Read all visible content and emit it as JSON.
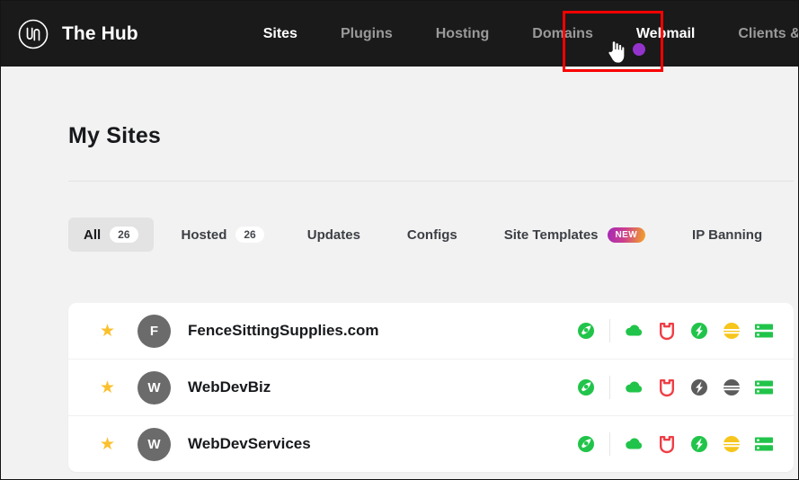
{
  "topbar": {
    "logo_icon": "wpmudev-circle-logo-icon",
    "brand": "The Hub",
    "nav": [
      {
        "label": "Sites",
        "active": true
      },
      {
        "label": "Plugins",
        "active": false
      },
      {
        "label": "Hosting",
        "active": false
      },
      {
        "label": "Domains",
        "active": false
      },
      {
        "label": "Webmail",
        "active": true
      },
      {
        "label": "Clients & Billing",
        "active": false
      }
    ],
    "highlight": {
      "target": "Webmail",
      "color": "#fa0000"
    },
    "cursor_icon": "pointing-hand-cursor-icon",
    "dot_color": "#9333cc",
    "bg_color": "#1a1a1a"
  },
  "page": {
    "title": "My Sites",
    "bg_color": "#f2f2f2"
  },
  "tabs": [
    {
      "label": "All",
      "count": "26",
      "active": true,
      "badge": ""
    },
    {
      "label": "Hosted",
      "count": "26",
      "active": false,
      "badge": ""
    },
    {
      "label": "Updates",
      "count": "",
      "active": false,
      "badge": ""
    },
    {
      "label": "Configs",
      "count": "",
      "active": false,
      "badge": ""
    },
    {
      "label": "Site Templates",
      "count": "",
      "active": false,
      "badge": "NEW"
    },
    {
      "label": "IP Banning",
      "count": "",
      "active": false,
      "badge": ""
    }
  ],
  "sites": [
    {
      "starred": true,
      "star_icon": "star-filled-icon",
      "avatar_letter": "F",
      "name": "FenceSittingSupplies.com",
      "services": [
        {
          "icon": "smush-globe-icon",
          "color": "#21c44a",
          "state": "active"
        },
        {
          "icon": "hummingbird-cloud-icon",
          "color": "#21c44a",
          "state": "active"
        },
        {
          "icon": "defender-shield-icon",
          "color": "#ef3e46",
          "state": "active"
        },
        {
          "icon": "hustle-bolt-icon",
          "color": "#21c44a",
          "state": "active"
        },
        {
          "icon": "forminator-sun-icon",
          "color": "#f6c61c",
          "state": "active"
        },
        {
          "icon": "beehive-list-icon",
          "color": "#21c44a",
          "state": "active"
        }
      ]
    },
    {
      "starred": true,
      "star_icon": "star-filled-icon",
      "avatar_letter": "W",
      "name": "WebDevBiz",
      "services": [
        {
          "icon": "smush-globe-icon",
          "color": "#21c44a",
          "state": "active"
        },
        {
          "icon": "hummingbird-cloud-icon",
          "color": "#21c44a",
          "state": "active"
        },
        {
          "icon": "defender-shield-icon",
          "color": "#ef3e46",
          "state": "active"
        },
        {
          "icon": "hustle-bolt-icon",
          "color": "#5c5c5c",
          "state": "inactive"
        },
        {
          "icon": "forminator-sun-icon",
          "color": "#5c5c5c",
          "state": "inactive"
        },
        {
          "icon": "beehive-list-icon",
          "color": "#21c44a",
          "state": "active"
        }
      ]
    },
    {
      "starred": true,
      "star_icon": "star-filled-icon",
      "avatar_letter": "W",
      "name": "WebDevServices",
      "services": [
        {
          "icon": "smush-globe-icon",
          "color": "#21c44a",
          "state": "active"
        },
        {
          "icon": "hummingbird-cloud-icon",
          "color": "#21c44a",
          "state": "active"
        },
        {
          "icon": "defender-shield-icon",
          "color": "#ef3e46",
          "state": "active"
        },
        {
          "icon": "hustle-bolt-icon",
          "color": "#21c44a",
          "state": "active"
        },
        {
          "icon": "forminator-sun-icon",
          "color": "#f6c61c",
          "state": "active"
        },
        {
          "icon": "beehive-list-icon",
          "color": "#21c44a",
          "state": "active"
        }
      ]
    }
  ]
}
